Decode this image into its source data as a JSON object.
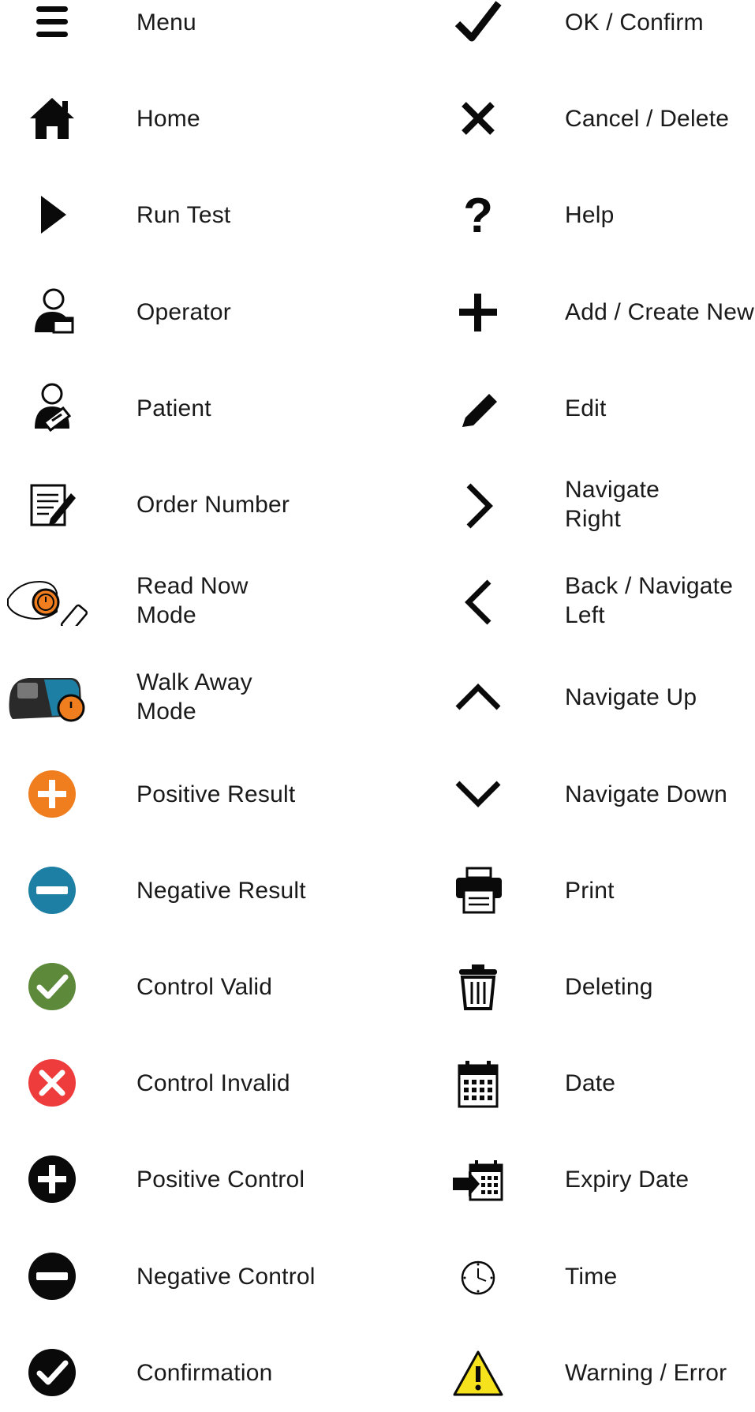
{
  "icon_legend": {
    "left": [
      {
        "icon": "menu-icon",
        "label": "Menu"
      },
      {
        "icon": "home-icon",
        "label": "Home"
      },
      {
        "icon": "play-icon",
        "label": "Run Test"
      },
      {
        "icon": "operator-icon",
        "label": "Operator"
      },
      {
        "icon": "patient-icon",
        "label": "Patient"
      },
      {
        "icon": "order-number-icon",
        "label": "Order Number"
      },
      {
        "icon": "read-now-mode-icon",
        "label": "Read Now\nMode"
      },
      {
        "icon": "walk-away-mode-icon",
        "label": "Walk Away\nMode"
      },
      {
        "icon": "positive-result-icon",
        "label": "Positive Result"
      },
      {
        "icon": "negative-result-icon",
        "label": "Negative Result"
      },
      {
        "icon": "control-valid-icon",
        "label": "Control Valid"
      },
      {
        "icon": "control-invalid-icon",
        "label": "Control Invalid"
      },
      {
        "icon": "positive-control-icon",
        "label": "Positive Control"
      },
      {
        "icon": "negative-control-icon",
        "label": "Negative Control"
      },
      {
        "icon": "confirmation-icon",
        "label": "Confirmation"
      }
    ],
    "right": [
      {
        "icon": "checkmark-icon",
        "label": "OK / Confirm"
      },
      {
        "icon": "cross-icon",
        "label": "Cancel / Delete"
      },
      {
        "icon": "question-mark-icon",
        "label": "Help"
      },
      {
        "icon": "plus-icon",
        "label": "Add / Create New"
      },
      {
        "icon": "pencil-icon",
        "label": "Edit"
      },
      {
        "icon": "chevron-right-icon",
        "label": "Navigate\nRight"
      },
      {
        "icon": "chevron-left-icon",
        "label": "Back / Navigate\nLeft"
      },
      {
        "icon": "chevron-up-icon",
        "label": "Navigate Up"
      },
      {
        "icon": "chevron-down-icon",
        "label": "Navigate Down"
      },
      {
        "icon": "printer-icon",
        "label": "Print"
      },
      {
        "icon": "trash-icon",
        "label": "Deleting"
      },
      {
        "icon": "calendar-icon",
        "label": "Date"
      },
      {
        "icon": "expiry-calendar-icon",
        "label": "Expiry Date"
      },
      {
        "icon": "clock-icon",
        "label": "Time"
      },
      {
        "icon": "warning-icon",
        "label": "Warning / Error"
      }
    ]
  },
  "colors": {
    "orange": "#f07d1e",
    "blue": "#1c7fa3",
    "green": "#5c8a3a",
    "red": "#ee3b3b",
    "yellow": "#f6e21c",
    "black": "#0a0a0a"
  }
}
